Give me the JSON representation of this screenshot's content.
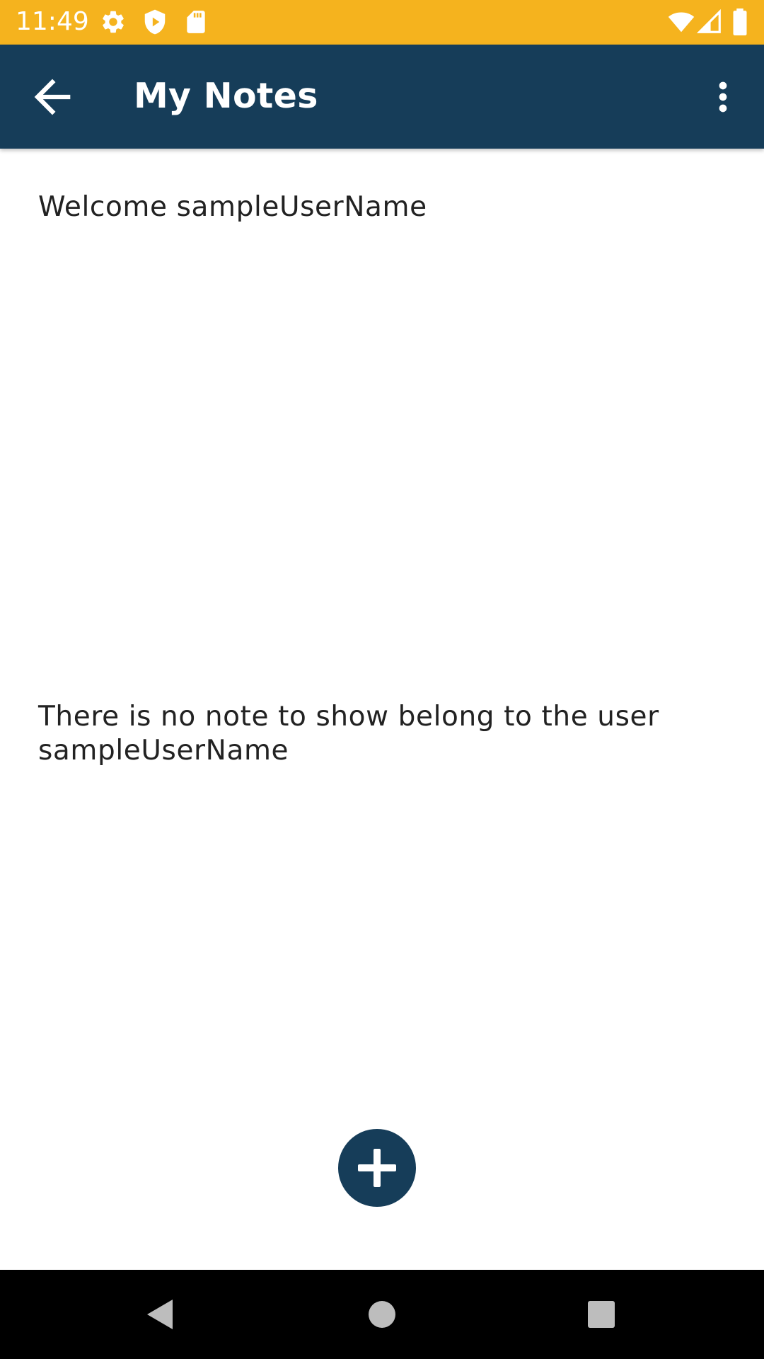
{
  "status_bar": {
    "time": "11:49",
    "background": "#f5b31e",
    "icons": [
      "gear-icon",
      "shield-play-icon",
      "sd-card-icon",
      "wifi-icon",
      "cell-signal-icon",
      "battery-icon"
    ]
  },
  "app_bar": {
    "title": "My Notes",
    "background": "#163d59",
    "nav_icon": "arrow-back-icon",
    "menu_icon": "more-vert-icon"
  },
  "content": {
    "welcome": "Welcome sampleUserName",
    "empty_message": "There is no note to show belong to the user sampleUserName"
  },
  "fab": {
    "icon": "plus-icon",
    "color": "#163d59"
  },
  "nav_bar": {
    "icons": [
      "back-triangle-icon",
      "home-circle-icon",
      "recents-square-icon"
    ]
  }
}
